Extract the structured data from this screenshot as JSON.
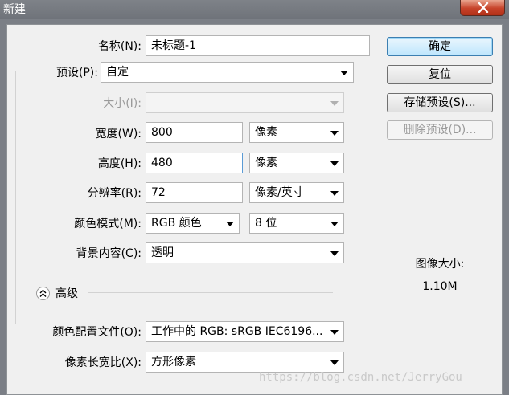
{
  "window": {
    "title": "新建"
  },
  "form": {
    "name": {
      "label": "名称(N):",
      "value": "未标题-1"
    },
    "preset": {
      "label": "预设(P):",
      "value": "自定"
    },
    "size": {
      "label": "大小(I):",
      "value": ""
    },
    "width": {
      "label": "宽度(W):",
      "value": "800",
      "unit": "像素"
    },
    "height": {
      "label": "高度(H):",
      "value": "480",
      "unit": "像素"
    },
    "resolution": {
      "label": "分辨率(R):",
      "value": "72",
      "unit": "像素/英寸"
    },
    "color_mode": {
      "label": "颜色模式(M):",
      "value": "RGB 颜色",
      "depth": "8 位"
    },
    "background": {
      "label": "背景内容(C):",
      "value": "透明"
    },
    "advanced": {
      "label": "高级"
    },
    "color_profile": {
      "label": "颜色配置文件(O):",
      "value": "工作中的 RGB: sRGB IEC6196..."
    },
    "pixel_aspect": {
      "label": "像素长宽比(X):",
      "value": "方形像素"
    }
  },
  "buttons": {
    "ok": "确定",
    "reset": "复位",
    "save_preset": "存储预设(S)...",
    "delete_preset": "删除预设(D)..."
  },
  "image_size": {
    "label": "图像大小:",
    "value": "1.10M"
  },
  "watermark": "https://blog.csdn.net/JerryGou",
  "colors": {
    "titlebar": "#7b7f86",
    "close_button": "#c7432a",
    "focus_border": "#5a9bd5"
  }
}
